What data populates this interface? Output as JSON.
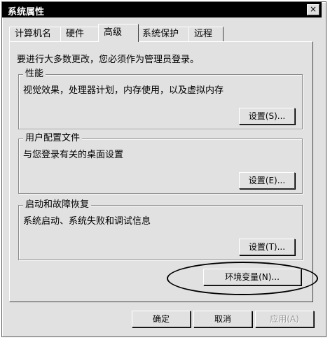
{
  "window": {
    "title": "系统属性",
    "close_label": "×"
  },
  "tabs": [
    {
      "label": "计算机名"
    },
    {
      "label": "硬件"
    },
    {
      "label": "高级"
    },
    {
      "label": "系统保护"
    },
    {
      "label": "远程"
    }
  ],
  "active_tab": "高级",
  "notice": "要进行大多数更改，您必须作为管理员登录。",
  "groups": [
    {
      "title": "性能",
      "description": "视觉效果，处理器计划，内存使用，以及虚拟内存",
      "button": "设置(S)..."
    },
    {
      "title": "用户配置文件",
      "description": "与您登录有关的桌面设置",
      "button": "设置(E)..."
    },
    {
      "title": "启动和故障恢复",
      "description": "系统启动、系统失败和调试信息",
      "button": "设置(T)..."
    }
  ],
  "env_button": "环境变量(N)...",
  "footer": {
    "ok": "确定",
    "cancel": "取消",
    "apply": "应用(A)"
  }
}
